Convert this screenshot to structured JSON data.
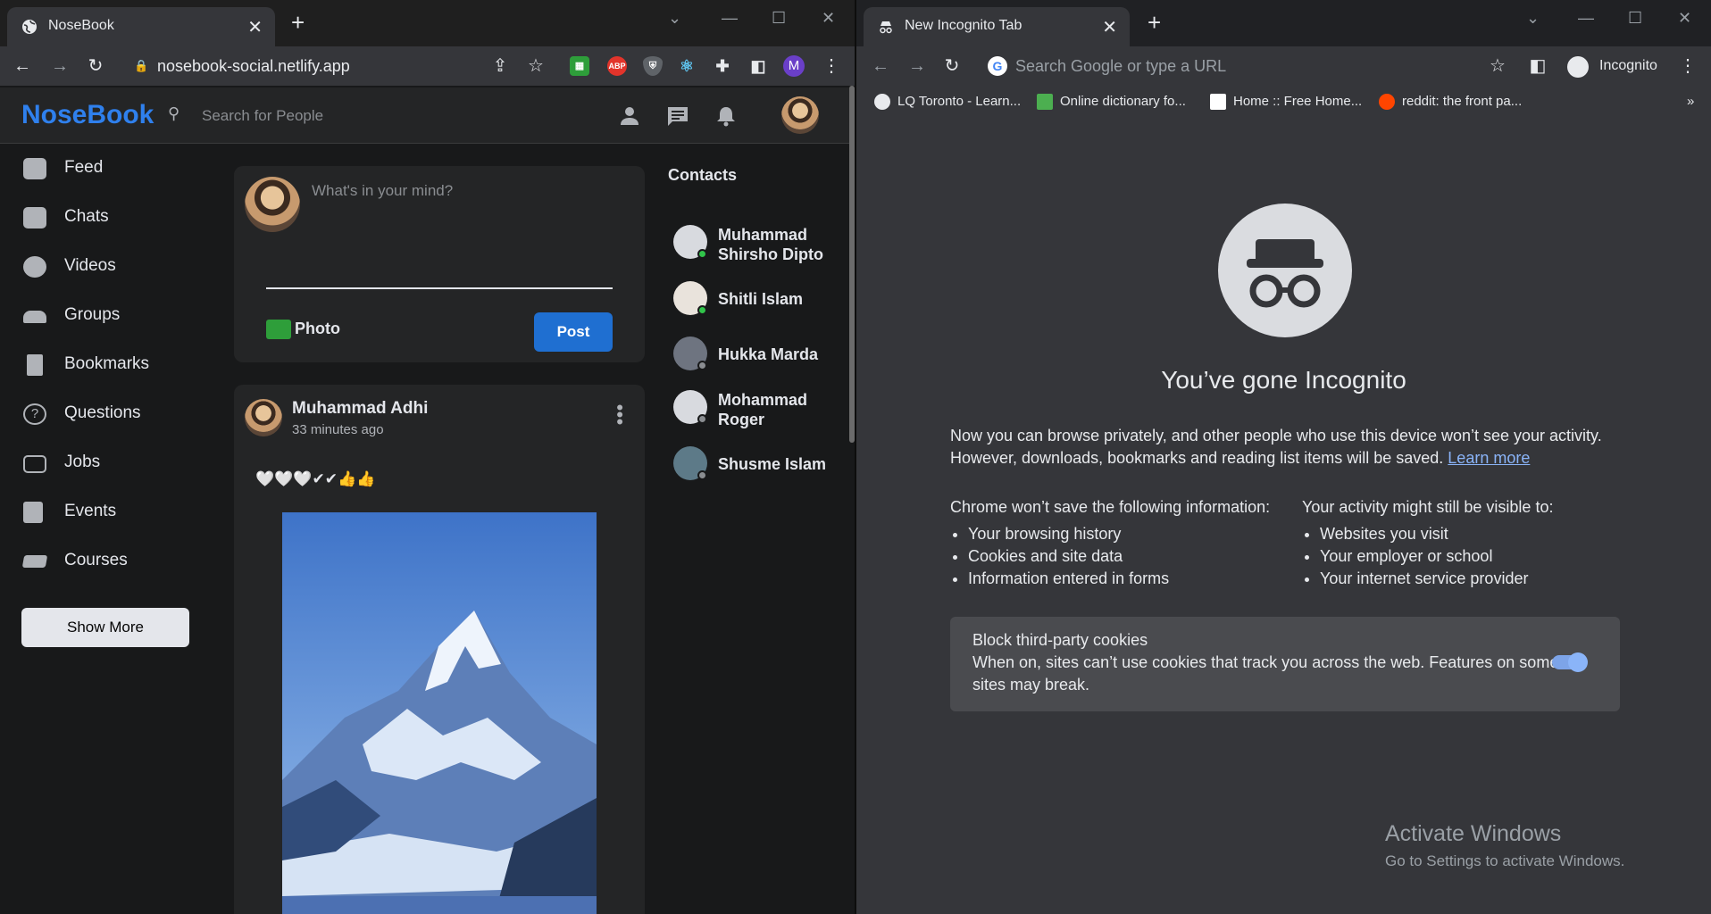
{
  "left_window": {
    "tab_title": "NoseBook",
    "url": "nosebook-social.netlify.app",
    "profile_initial": "M",
    "ext_abp": "ABP",
    "app": {
      "logo": "NoseBook",
      "search_placeholder": "Search for People",
      "sidebar": [
        {
          "label": "Feed"
        },
        {
          "label": "Chats"
        },
        {
          "label": "Videos"
        },
        {
          "label": "Groups"
        },
        {
          "label": "Bookmarks"
        },
        {
          "label": "Questions"
        },
        {
          "label": "Jobs"
        },
        {
          "label": "Events"
        },
        {
          "label": "Courses"
        }
      ],
      "show_more": "Show More",
      "composer": {
        "placeholder": "What's in your mind?",
        "photo_label": "Photo",
        "post_label": "Post"
      },
      "post": {
        "author": "Muhammad Adhi",
        "time": "33 minutes ago",
        "text": "🤍🤍🤍✔✔👍👍"
      },
      "contacts_title": "Contacts",
      "contacts": [
        {
          "name": "Muhammad Shirsho Dipto",
          "online": true
        },
        {
          "name": "Shitli Islam",
          "online": true
        },
        {
          "name": "Hukka Marda",
          "online": false
        },
        {
          "name": "Mohammad Roger",
          "online": false
        },
        {
          "name": "Shusme Islam",
          "online": false
        }
      ]
    }
  },
  "right_window": {
    "tab_title": "New Incognito Tab",
    "omnibox_placeholder": "Search Google or type a URL",
    "profile_label": "Incognito",
    "bookmarks": [
      {
        "label": "LQ Toronto - Learn...",
        "color": "#e8eaed"
      },
      {
        "label": "Online dictionary fo...",
        "color": "#4caf50"
      },
      {
        "label": "Home :: Free Home...",
        "color": "#ffffff"
      },
      {
        "label": "reddit: the front pa...",
        "color": "#ff4500"
      }
    ],
    "bookmarks_overflow": "»",
    "page": {
      "title": "You’ve gone Incognito",
      "intro_1": "Now you can browse privately, and other people who use this device won’t see your activity.",
      "intro_2": "However, downloads, bookmarks and reading list items will be saved.",
      "learn_more": "Learn more",
      "left_col_title": "Chrome won’t save the following information:",
      "left_col_items": [
        "Your browsing history",
        "Cookies and site data",
        "Information entered in forms"
      ],
      "right_col_title": "Your activity might still be visible to:",
      "right_col_items": [
        "Websites you visit",
        "Your employer or school",
        "Your internet service provider"
      ],
      "cookie_title": "Block third-party cookies",
      "cookie_desc": "When on, sites can’t use cookies that track you across the web. Features on some sites may break.",
      "cookie_toggle_on": true
    },
    "watermark": {
      "line1": "Activate Windows",
      "line2": "Go to Settings to activate Windows."
    }
  }
}
